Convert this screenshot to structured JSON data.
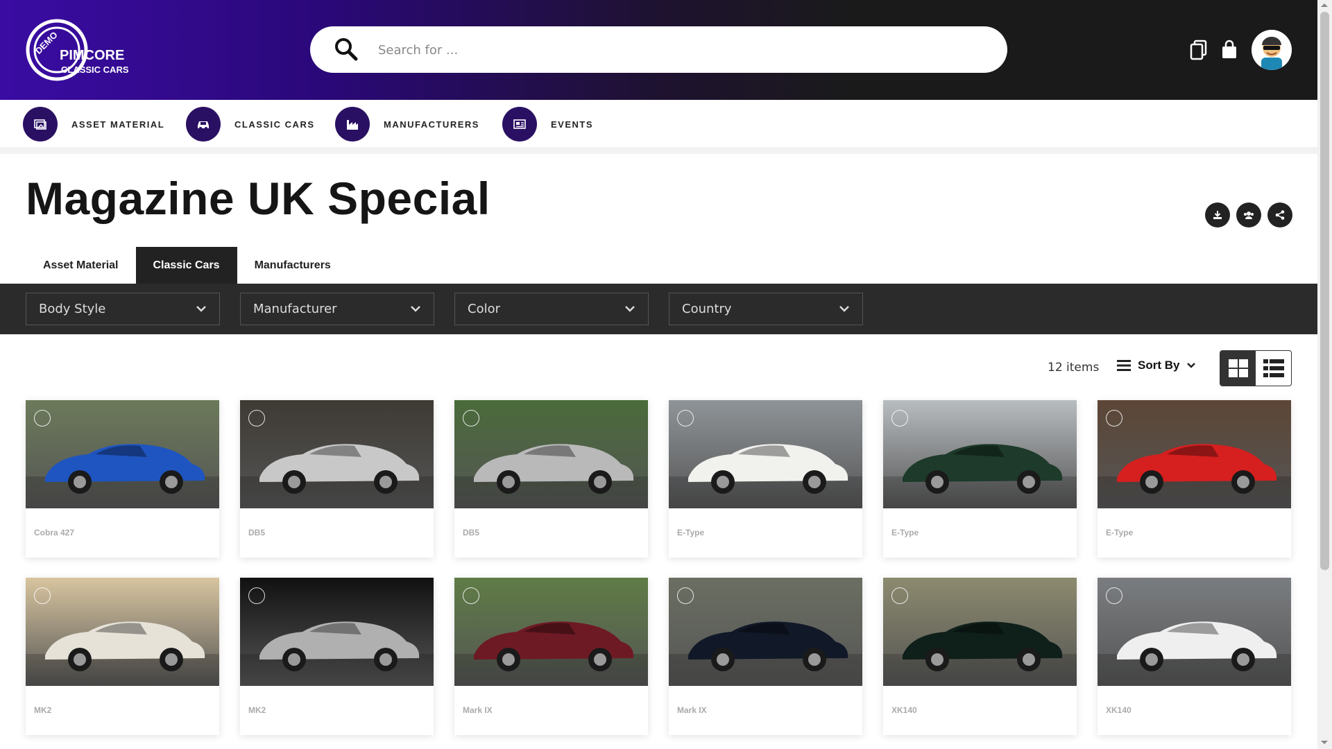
{
  "header": {
    "logo": {
      "badge": "DEMO",
      "brand": "PIMCORE",
      "sub": "CLASSIC CARS"
    },
    "search_placeholder": "Search for ...",
    "icons": [
      "copy-icon",
      "shopping-bag-icon",
      "user-avatar"
    ]
  },
  "nav": [
    {
      "label": "ASSET MATERIAL",
      "icon": "image-gallery-icon"
    },
    {
      "label": "CLASSIC CARS",
      "icon": "car-icon"
    },
    {
      "label": "MANUFACTURERS",
      "icon": "factory-icon"
    },
    {
      "label": "EVENTS",
      "icon": "news-icon"
    }
  ],
  "page": {
    "title": "Magazine UK Special",
    "actions": [
      "download-icon",
      "group-icon",
      "share-icon"
    ]
  },
  "tabs": [
    {
      "label": "Asset Material",
      "active": false
    },
    {
      "label": "Classic Cars",
      "active": true
    },
    {
      "label": "Manufacturers",
      "active": false
    }
  ],
  "filters": [
    "Body Style",
    "Manufacturer",
    "Color",
    "Country"
  ],
  "toolbar": {
    "count": "12 items",
    "sort_label": "Sort By",
    "view": "grid"
  },
  "cards": [
    {
      "caption": "Cobra 427",
      "car": "#1f55c0",
      "bg": "#6c7a5a"
    },
    {
      "caption": "DB5",
      "car": "#c8c8c8",
      "bg": "#3e3a34"
    },
    {
      "caption": "DB5",
      "car": "#b9b9b9",
      "bg": "#4a6b3a"
    },
    {
      "caption": "E-Type",
      "car": "#f1f1ee",
      "bg": "#8f9498"
    },
    {
      "caption": "E-Type",
      "car": "#1d3a2a",
      "bg": "#b8bdc0"
    },
    {
      "caption": "E-Type",
      "car": "#d61f1f",
      "bg": "#5c4636"
    },
    {
      "caption": "MK2",
      "car": "#e6e2d8",
      "bg": "#d8c59f"
    },
    {
      "caption": "MK2",
      "car": "#b0b0b0",
      "bg": "#111111"
    },
    {
      "caption": "Mark IX",
      "car": "#6e1a24",
      "bg": "#5f7c46"
    },
    {
      "caption": "Mark IX",
      "car": "#111827",
      "bg": "#6b6f62"
    },
    {
      "caption": "XK140",
      "car": "#0f1f1a",
      "bg": "#8c8a6e"
    },
    {
      "caption": "XK140",
      "car": "#efefef",
      "bg": "#7a7d80"
    }
  ]
}
